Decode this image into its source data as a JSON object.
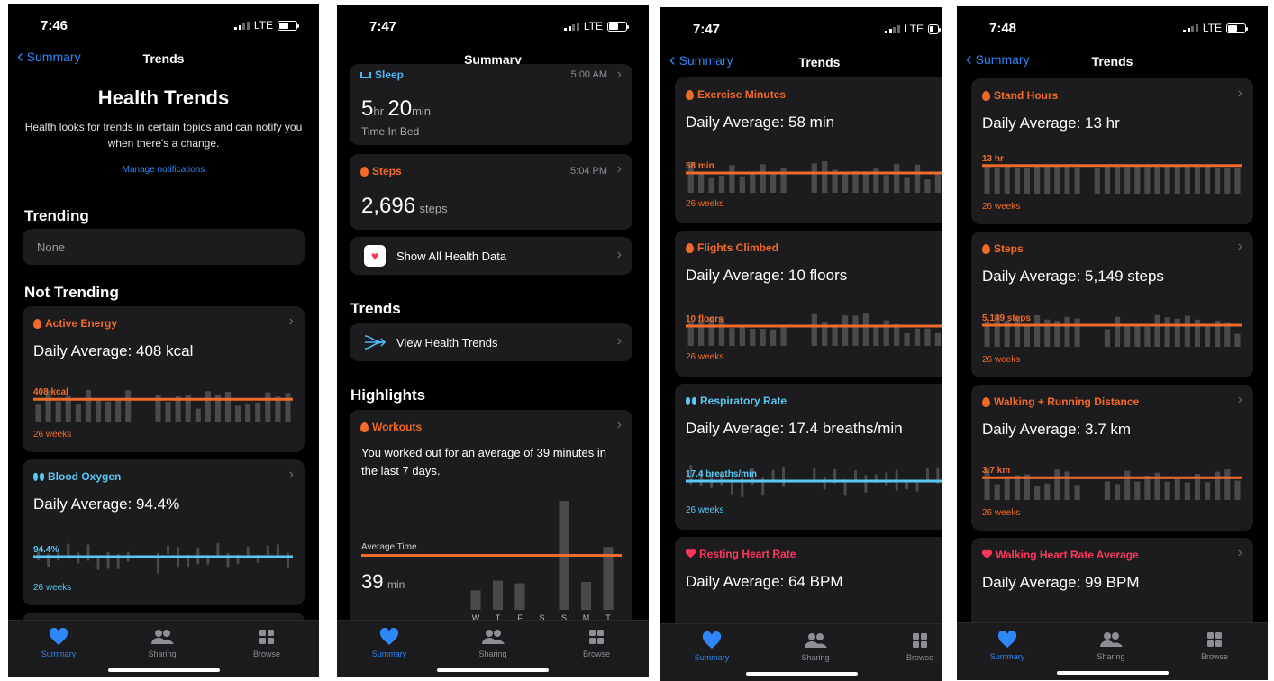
{
  "colors": {
    "orange": "#f06a2a",
    "blue": "#5ac8f5",
    "pink": "#ff375f",
    "accent": "#2f86f6",
    "bar": "#4a4a4c"
  },
  "tabbar": {
    "summary": "Summary",
    "sharing": "Sharing",
    "browse": "Browse"
  },
  "screen1": {
    "time": "7:46",
    "network": "LTE",
    "back_label": "Summary",
    "nav_title": "Trends",
    "title": "Health Trends",
    "description": "Health looks for trends in certain topics and can notify you when there's a change.",
    "manage_link": "Manage notifications",
    "trending_header": "Trending",
    "trending_value": "None",
    "not_trending_header": "Not Trending",
    "cards": [
      {
        "title": "Active Energy",
        "average": "Daily Average: 408 kcal",
        "line_label": "408 kcal",
        "period": "26 weeks",
        "icon": "flame-icon"
      },
      {
        "title": "Blood Oxygen",
        "average": "Daily Average: 94.4%",
        "line_label": "94.4%",
        "period": "26 weeks",
        "icon": "lungs-icon"
      }
    ]
  },
  "screen2": {
    "time": "7:47",
    "network": "LTE",
    "nav_title": "Summary",
    "sleep": {
      "title": "Sleep",
      "time": "5:00 AM",
      "hours": "5",
      "hr_unit": "hr",
      "minutes": "20",
      "min_unit": "min",
      "caption": "Time In Bed"
    },
    "steps": {
      "title": "Steps",
      "time": "5:04 PM",
      "value": "2,696",
      "unit": "steps"
    },
    "show_all": "Show All Health Data",
    "trends_header": "Trends",
    "view_trends": "View Health Trends",
    "highlights_header": "Highlights",
    "workouts": {
      "title": "Workouts",
      "text": "You worked out for an average of 39 minutes in the last 7 days.",
      "avg_label": "Average Time",
      "avg_value": "39",
      "avg_unit": "min",
      "days": [
        "W",
        "T",
        "F",
        "S",
        "S",
        "M",
        "T"
      ],
      "minutes": [
        14,
        21,
        19,
        0,
        78,
        20,
        45
      ],
      "average_minutes": 39
    }
  },
  "screen3": {
    "time": "7:47",
    "network": "LTE",
    "back_label": "Summary",
    "nav_title": "Trends",
    "cards": [
      {
        "title": "Exercise Minutes",
        "average": "Daily Average: 58 min",
        "line_label": "58 min",
        "period": "26 weeks"
      },
      {
        "title": "Flights Climbed",
        "average": "Daily Average: 10 floors",
        "line_label": "10 floors",
        "period": "26 weeks"
      },
      {
        "title": "Respiratory Rate",
        "average": "Daily Average: 17.4 breaths/min",
        "line_label": "17.4 breaths/min",
        "period": "26 weeks"
      },
      {
        "title": "Resting Heart Rate",
        "average": "Daily Average: 64 BPM"
      }
    ]
  },
  "screen4": {
    "time": "7:48",
    "network": "LTE",
    "back_label": "Summary",
    "nav_title": "Trends",
    "cards": [
      {
        "title": "Stand Hours",
        "average": "Daily Average: 13 hr",
        "line_label": "13 hr",
        "period": "26 weeks"
      },
      {
        "title": "Steps",
        "average": "Daily Average: 5,149 steps",
        "line_label": "5,149 steps",
        "period": "26 weeks"
      },
      {
        "title": "Walking + Running Distance",
        "average": "Daily Average: 3.7 km",
        "line_label": "3.7 km",
        "period": "26 weeks"
      },
      {
        "title": "Walking Heart Rate Average",
        "average": "Daily Average: 99 BPM"
      }
    ]
  }
}
